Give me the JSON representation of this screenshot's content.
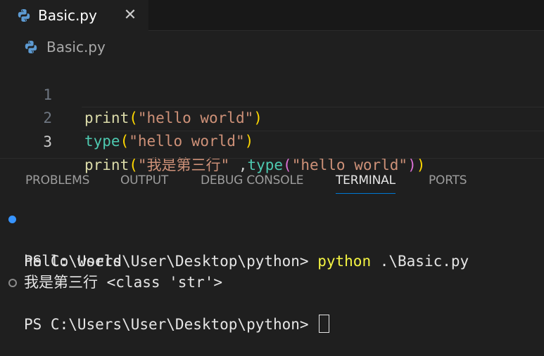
{
  "tab": {
    "label": "Basic.py"
  },
  "breadcrumb": {
    "file": "Basic.py"
  },
  "editor": {
    "lines": [
      {
        "number": "1",
        "fn": "print",
        "open": "(",
        "str": "\"hello world\"",
        "close": ")"
      },
      {
        "number": "2",
        "fn": "type",
        "open": "(",
        "str": "\"hello world\"",
        "close": ")"
      },
      {
        "number": "3",
        "fn": "print",
        "open": "(",
        "str": "\"我是第三行\"",
        "mid": " ,",
        "fn2": "type",
        "open2": "(",
        "str2": "\"hello world\"",
        "close2": ")",
        "close": ")"
      }
    ]
  },
  "panel": {
    "tabs": [
      "PROBLEMS",
      "OUTPUT",
      "DEBUG CONSOLE",
      "TERMINAL",
      "PORTS"
    ],
    "active_tab": "TERMINAL"
  },
  "terminal": {
    "prompt1": "PS C:\\Users\\User\\Desktop\\python> ",
    "command": "python",
    "args": " .\\Basic.py",
    "output1": "hello world",
    "output2": "我是第三行 <class 'str'>",
    "prompt2": "PS C:\\Users\\User\\Desktop\\python> "
  },
  "colors": {
    "accent": "#0078d4",
    "command_highlight": "#f5f543",
    "success_dot": "#3794ff"
  },
  "icons": {
    "file_icon": "python-icon",
    "close": "close-icon"
  }
}
